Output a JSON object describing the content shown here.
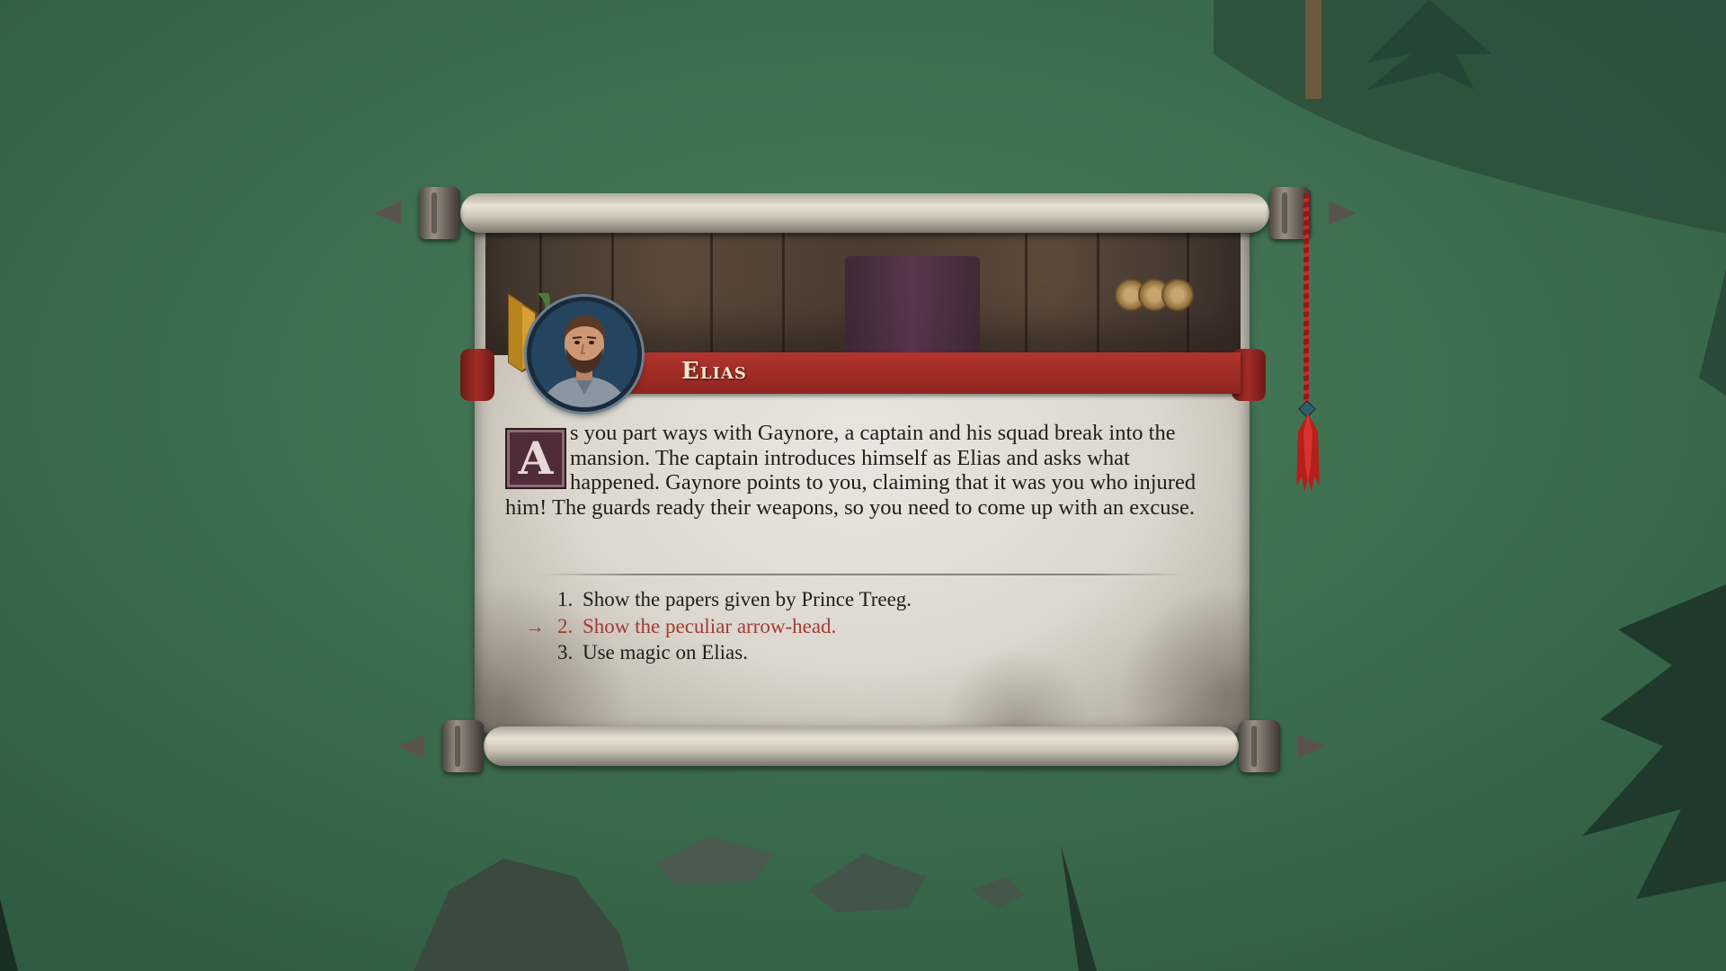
{
  "dialog": {
    "speaker_name": "Elias",
    "drop_cap": "A",
    "narration": "s you part ways with Gaynore, a captain and his squad break into the mansion. The captain introduces himself as Elias and asks what happened. Gaynore points to you, claiming that it was you who injured him! The guards ready their weapons, so you need to come up with an excuse.",
    "choice_pointer": "→",
    "choices": [
      {
        "number": "1.",
        "text": "Show the papers given by Prince Treeg."
      },
      {
        "number": "2.",
        "text": "Show the peculiar arrow-head."
      },
      {
        "number": "3.",
        "text": "Use magic on Elias."
      }
    ],
    "selected_choice": 2
  },
  "icons": {
    "portrait": "character-portrait-icon",
    "crest": "heraldic-crest-icon",
    "pointer": "arrow-right-icon",
    "tassel": "tassel-icon"
  },
  "colors": {
    "banner": "#a12c26",
    "selected_choice": "#a23b36",
    "text": "#231c18",
    "background": "#3f7352"
  }
}
